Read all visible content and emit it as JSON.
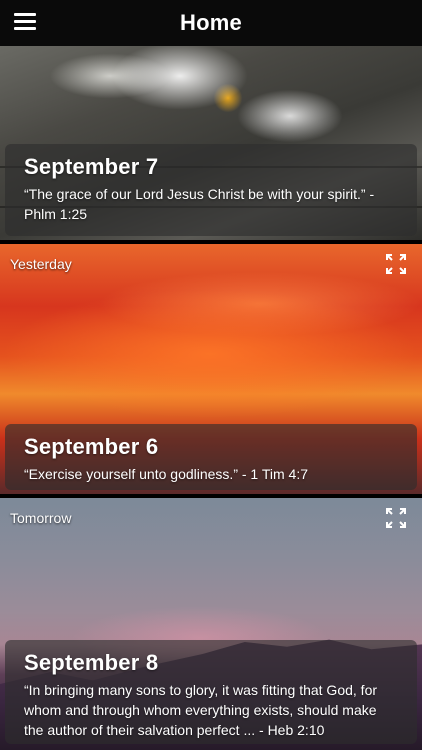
{
  "header": {
    "title": "Home",
    "menu_icon": "hamburger-menu-icon"
  },
  "cards": [
    {
      "date": "September 7",
      "verse": "“The grace of our Lord Jesus Christ be with your spirit.” - Phlm 1:25",
      "background": "daisies-on-wood"
    },
    {
      "label": "Yesterday",
      "date": "September 6",
      "verse": "“Exercise yourself unto godliness.” - 1 Tim 4:7",
      "background": "orange-sunset-sky",
      "expand_icon": "expand-icon"
    },
    {
      "label": "Tomorrow",
      "date": "September 8",
      "verse": "“In bringing many sons to glory, it was fitting that God, for whom and through whom everything exists, should make the author of their salvation perfect ... - Heb 2:10",
      "background": "purple-mountain-dusk",
      "expand_icon": "expand-icon"
    }
  ],
  "colors": {
    "topbar": "#0a0a0a",
    "text": "#ffffff",
    "info_panel": "rgba(45,45,45,0.62)"
  }
}
